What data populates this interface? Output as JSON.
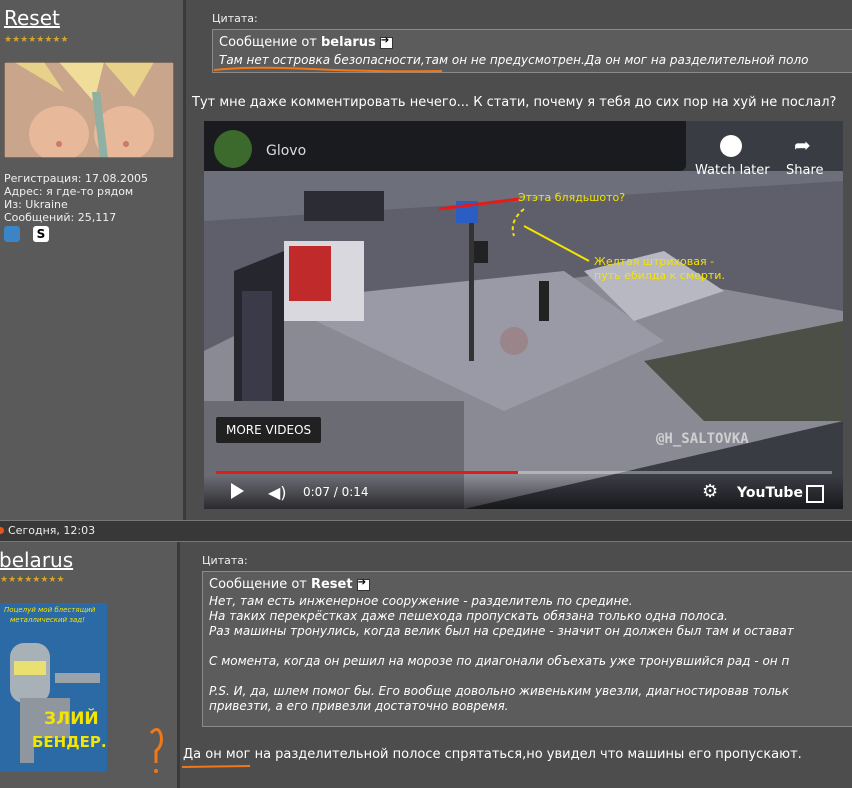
{
  "post1": {
    "username": "Reset",
    "stars": "★★★★★★★★",
    "info": {
      "registration": "Регистрация: 17.08.2005",
      "address": "Адрес: я где-то рядом",
      "from": "Из: Ukraine",
      "messages": "Сообщений: 25,117"
    },
    "quote": {
      "label": "Цитата:",
      "from_prefix": "Сообщение от ",
      "author": "belarus",
      "text": "Там нет островка безопасности,там он не предусмотрен.Да он мог на разделительной поло"
    },
    "text": "Тут мне даже комментировать нечего... К стати, почему я тебя до сих пор на хуй не послал?"
  },
  "video": {
    "channel": "Glovo",
    "watch_later": "Watch later",
    "share": "Share",
    "more_videos": "MORE VIDEOS",
    "time": "0:07 / 0:14",
    "youtube": "YouTube",
    "watermark": "@H_SALTOVKA",
    "annotation1": "Этэта блядьшото?",
    "annotation2a": "Желтая штриховая -",
    "annotation2b": "путь ебилда к смерти.",
    "progress": 0.49,
    "progress_color": "#e31b1b"
  },
  "datebar": {
    "text": "Сегодня, 12:03"
  },
  "post2": {
    "username": "belarus",
    "stars": "★★★★★★★★",
    "avatar_text1": "Поцелуй мой блестящий",
    "avatar_text2": "металлический зад!",
    "avatar_text3": "ЗЛИЙ",
    "avatar_text4": "БЕНДЕР.",
    "quote": {
      "label": "Цитата:",
      "from_prefix": "Сообщение от ",
      "author": "Reset",
      "line1": "Нет, там есть инженерное сооружение - разделитель по средине.",
      "line2": "На таких перекрёстках даже пешехода пропускать обязана только одна полоса.",
      "line3": "Раз машины тронулись, когда велик был на средине - значит он должен был там и остават",
      "line4": "С момента, когда он решил на морозе по диагонали объехать уже тронувшийся рад - он п",
      "line5": "P.S. И, да, шлем помог бы. Его вообще довольно живеньким увезли, диагностировав тольк",
      "line6": "привезти, а его привезли достаточно вовремя."
    },
    "text": "Да он мог на разделительной полосе спрятаться,но увидел что машины его пропускают."
  },
  "colors": {
    "annotation_yellow": "#f5e400",
    "markup_orange": "#f07818"
  }
}
